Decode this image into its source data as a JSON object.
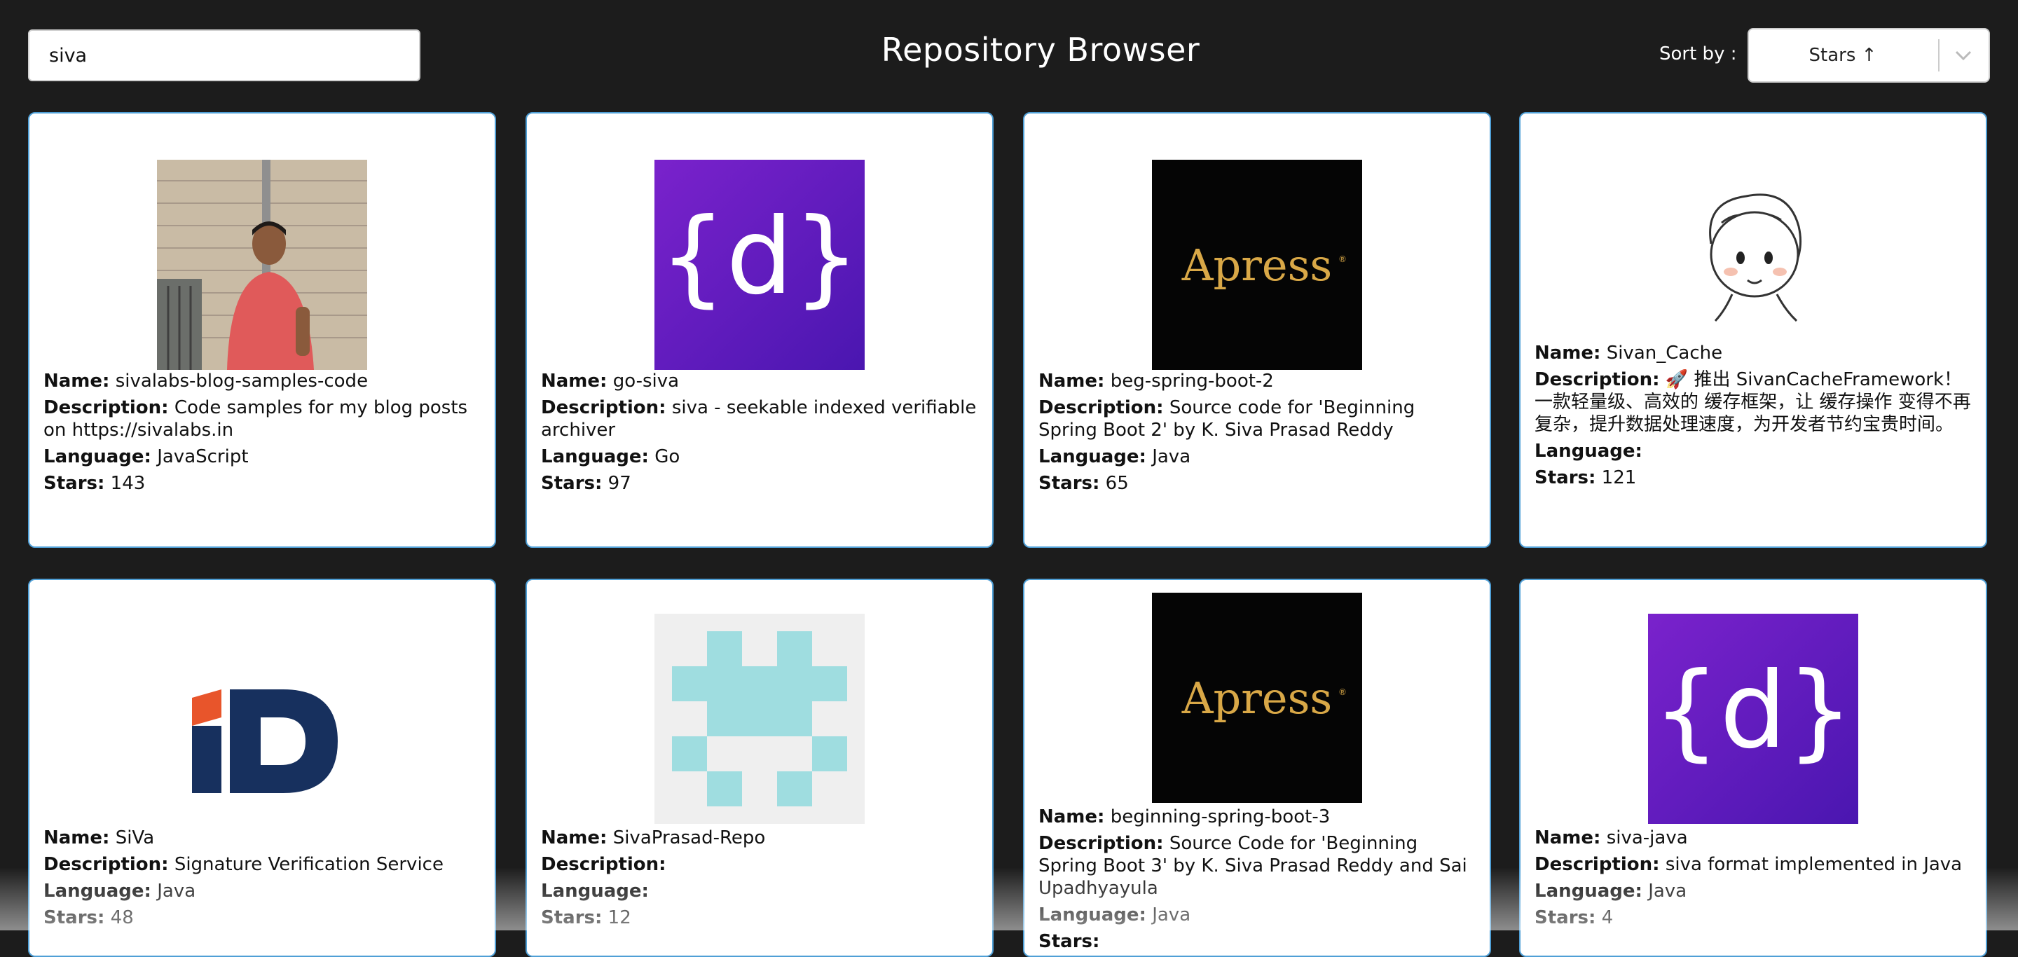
{
  "header": {
    "search_value": "siva",
    "title": "Repository Browser",
    "sort_label": "Sort by :",
    "sort_value": "Stars ↑"
  },
  "labels": {
    "name": "Name:",
    "description": "Description:",
    "language": "Language:",
    "stars": "Stars:"
  },
  "repos": [
    {
      "name": "sivalabs-blog-samples-code",
      "description": "Code samples for my blog posts on https://sivalabs.in",
      "language": "JavaScript",
      "stars": "143",
      "avatar": "person-photo"
    },
    {
      "name": "go-siva",
      "description": "siva - seekable indexed verifiable archiver",
      "language": "Go",
      "stars": "97",
      "avatar": "src-d-logo"
    },
    {
      "name": "beg-spring-boot-2",
      "description": "Source code for 'Beginning Spring Boot 2' by K. Siva Prasad Reddy",
      "language": "Java",
      "stars": "65",
      "avatar": "apress-logo"
    },
    {
      "name": "Sivan_Cache",
      "description": "🚀 推出 SivanCacheFramework！一款轻量级、高效的 缓存框架，让 缓存操作 变得不再复杂，提升数据处理速度，为开发者节约宝贵时间。",
      "language": "",
      "stars": "121",
      "avatar": "cartoon-boy"
    },
    {
      "name": "SiVa",
      "description": "Signature Verification Service",
      "language": "Java",
      "stars": "48",
      "avatar": "id-logo"
    },
    {
      "name": "SivaPrasad-Repo",
      "description": "",
      "language": "",
      "stars": "12",
      "avatar": "identicon"
    },
    {
      "name": "beginning-spring-boot-3",
      "description": "Source Code for 'Beginning Spring Boot 3' by K. Siva Prasad Reddy and Sai Upadhyayula",
      "language": "Java",
      "stars": "",
      "avatar": "apress-logo"
    },
    {
      "name": "siva-java",
      "description": "siva format implemented in Java",
      "language": "Java",
      "stars": "4",
      "avatar": "src-d-logo"
    }
  ],
  "colors": {
    "background": "#1c1c1c",
    "card_border": "#4f9fd6",
    "src_d_purple": "#6a1fc6",
    "apress_gold": "#d9a847",
    "id_blue": "#17305e",
    "id_orange": "#e8552b",
    "identicon": "#9fdde0"
  }
}
